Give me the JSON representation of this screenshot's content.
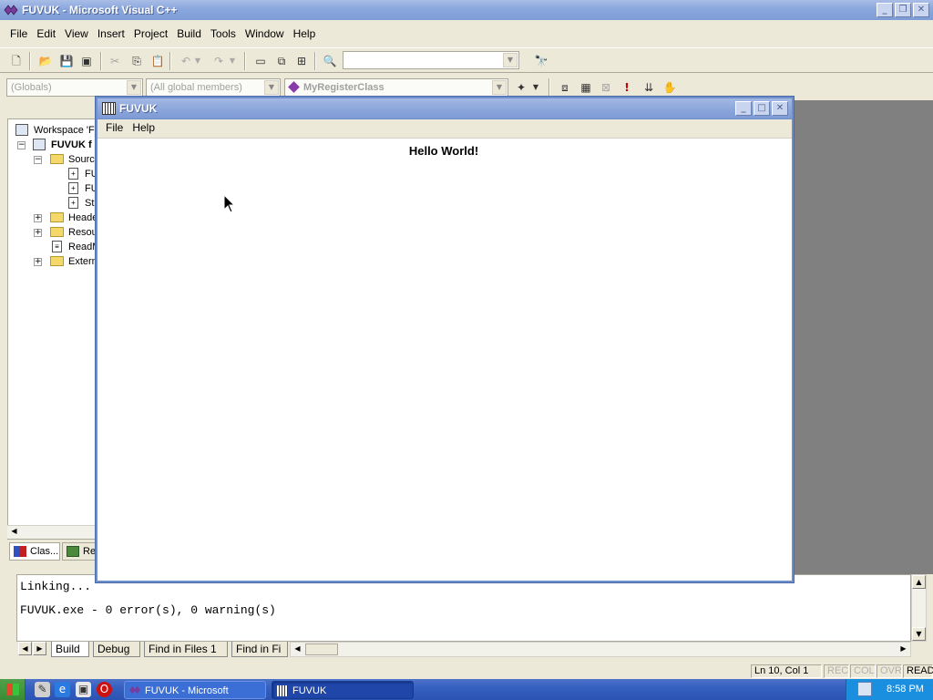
{
  "app": {
    "title": "FUVUK - Microsoft Visual C++"
  },
  "menu": [
    {
      "label": "File"
    },
    {
      "label": "Edit"
    },
    {
      "label": "View"
    },
    {
      "label": "Insert"
    },
    {
      "label": "Project"
    },
    {
      "label": "Build"
    },
    {
      "label": "Tools"
    },
    {
      "label": "Window"
    },
    {
      "label": "Help"
    }
  ],
  "wizardbar": {
    "class_combo": "(Globals)",
    "filter_combo": "(All global members)",
    "members_combo": "MyRegisterClass"
  },
  "workspace": {
    "rows": [
      {
        "label": "Workspace 'FU"
      },
      {
        "label": "FUVUK f"
      },
      {
        "label": "Source"
      },
      {
        "label": "FU"
      },
      {
        "label": "FU"
      },
      {
        "label": "St"
      },
      {
        "label": "Heade"
      },
      {
        "label": "Resou"
      },
      {
        "label": "ReadM"
      },
      {
        "label": "Extern"
      }
    ],
    "tabs": [
      {
        "label": "Clas..."
      },
      {
        "label": "Re"
      }
    ]
  },
  "child_window": {
    "title": "FUVUK",
    "menu": [
      {
        "label": "File"
      },
      {
        "label": "Help"
      }
    ],
    "content": "Hello World!"
  },
  "output": {
    "lines": [
      "Linking...",
      "FUVUK.exe - 0 error(s), 0 warning(s)"
    ],
    "tabs": [
      {
        "label": "Build"
      },
      {
        "label": "Debug"
      },
      {
        "label": "Find in Files 1"
      },
      {
        "label": "Find in Fi"
      }
    ]
  },
  "status": {
    "position": "Ln 10, Col 1",
    "rec": "REC",
    "col": "COL",
    "ovr": "OVR",
    "read": "READ"
  },
  "taskbar": {
    "tasks": [
      {
        "label": "FUVUK - Microsoft Visual..."
      },
      {
        "label": "FUVUK"
      }
    ],
    "clock": "8:58 PM"
  },
  "colors": {
    "title_bar": "#8aa7dd",
    "desktop_gray": "#808080",
    "taskbar": "#3660c0"
  }
}
